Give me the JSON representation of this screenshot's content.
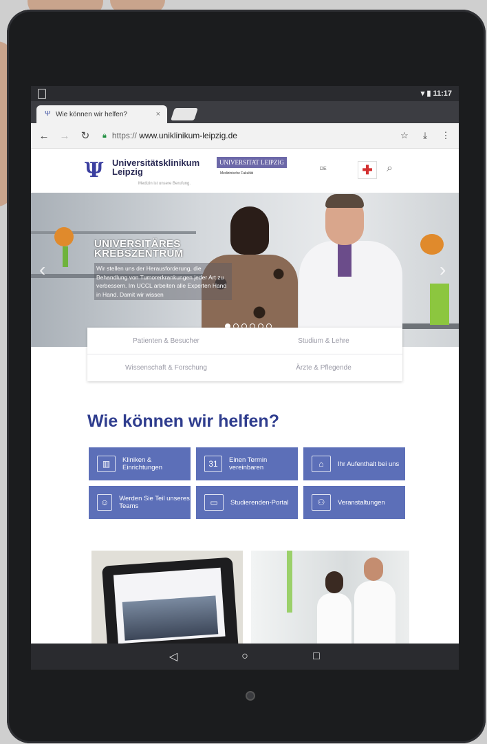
{
  "status_bar": {
    "time": "11:17"
  },
  "browser": {
    "tab_title": "Wie können wir helfen?",
    "tab_close": "×",
    "url_scheme": "https://",
    "url_host": "www.uniklinikum-leipzig.de"
  },
  "site": {
    "logo_name_line1": "Universitätsklinikum",
    "logo_name_line2": "Leipzig",
    "logo_tagline": "Medizin ist unsere Berufung.",
    "university_label": "UNIVERSITAT LEIPZIG",
    "university_sub": "Medizinische Fakultät",
    "language": "DE"
  },
  "hero": {
    "title_line1": "UNIVERSITÄRES",
    "title_line2": "KREBSZENTRUM",
    "text": "Wir stellen uns der Herausforderung, die Behandlung von Tumorerkrankungen jeder Art zu verbessern. Im UCCL arbeiten alle Experten Hand in Hand. Damit wir wissen",
    "slide_count": 6,
    "active_slide": 1
  },
  "quick_nav": {
    "items": [
      "Patienten & Besucher",
      "Studium & Lehre",
      "Wissenschaft & Forschung",
      "Ärzte & Pflegende"
    ]
  },
  "help": {
    "title": "Wie können wir helfen?",
    "tiles": [
      {
        "label": "Kliniken & Einrichtungen",
        "icon": "building-icon"
      },
      {
        "label": "Einen Termin vereinbaren",
        "icon": "calendar-icon"
      },
      {
        "label": "Ihr Aufenthalt bei uns",
        "icon": "bed-icon"
      },
      {
        "label": "Werden Sie Teil unseres Teams",
        "icon": "team-icon"
      },
      {
        "label": "Studierenden-Portal",
        "icon": "monitor-icon"
      },
      {
        "label": "Veranstaltungen",
        "icon": "people-icon"
      }
    ]
  },
  "colors": {
    "brand_blue": "#2f3d8e",
    "tile_blue": "#5c6fb8",
    "university_purple": "#6c68a8",
    "cross_red": "#d32f2f"
  }
}
